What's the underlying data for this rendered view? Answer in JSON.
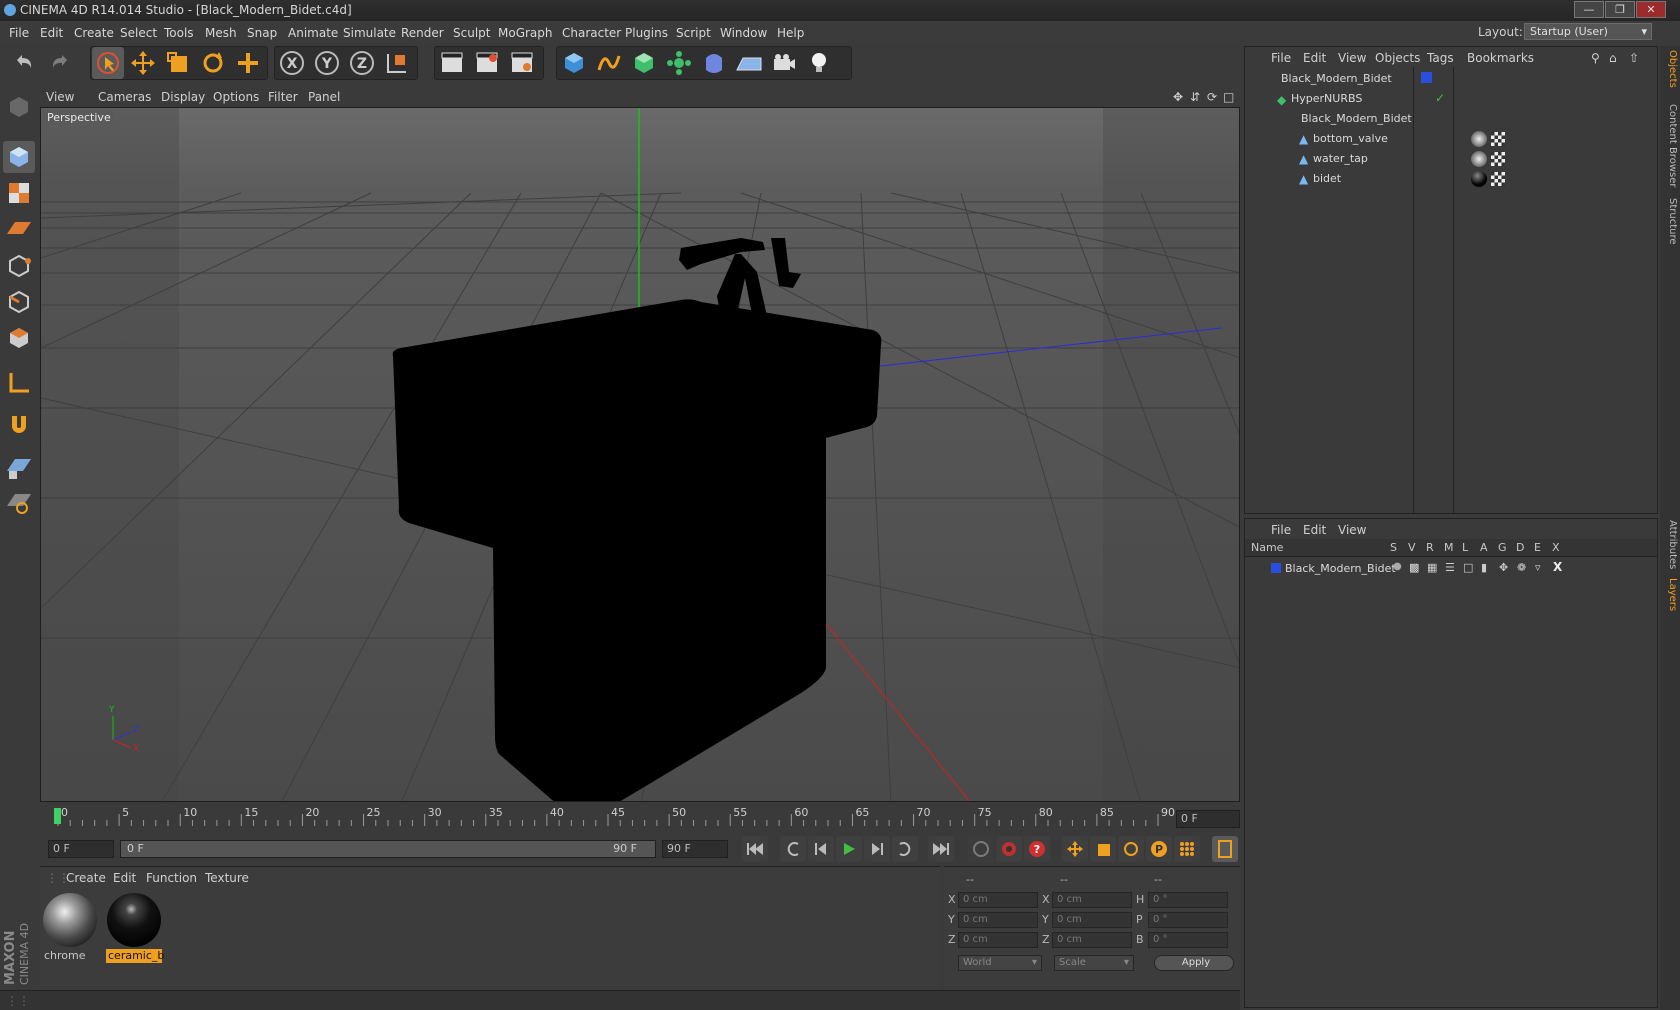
{
  "window": {
    "title": "CINEMA 4D R14.014 Studio - [Black_Modern_Bidet.c4d]"
  },
  "menubar": {
    "items": [
      "File",
      "Edit",
      "Create",
      "Select",
      "Tools",
      "Mesh",
      "Snap",
      "Animate",
      "Simulate",
      "Render",
      "Sculpt",
      "MoGraph",
      "Character",
      "Plugins",
      "Script",
      "Window",
      "Help"
    ],
    "layout_label": "Layout:",
    "layout_value": "Startup (User)"
  },
  "toolbar": {
    "icons": [
      "undo-icon",
      "redo-icon",
      "live-selection-icon",
      "move-icon",
      "scale-icon",
      "rotate-icon",
      "add-icon",
      "x-axis-icon",
      "y-axis-icon",
      "z-axis-icon",
      "coordinate-system-icon",
      "render-view-icon",
      "render-picture-viewer-icon",
      "render-settings-icon",
      "cube-icon",
      "spline-icon",
      "nurbs-icon",
      "array-icon",
      "deformer-icon",
      "floor-icon",
      "camera-icon",
      "light-icon"
    ]
  },
  "viewport": {
    "menu": [
      "View",
      "Cameras",
      "Display",
      "Options",
      "Filter",
      "Panel"
    ],
    "label": "Perspective"
  },
  "timeline": {
    "ticks": [
      "0",
      "5",
      "10",
      "15",
      "20",
      "25",
      "30",
      "35",
      "40",
      "45",
      "50",
      "55",
      "60",
      "65",
      "70",
      "75",
      "80",
      "85",
      "90"
    ],
    "current_frame": "0 F",
    "start_field": "0 F",
    "range_start": "0 F",
    "range_end": "90 F",
    "end_field": "90 F"
  },
  "materials": {
    "menu": [
      "Create",
      "Edit",
      "Function",
      "Texture"
    ],
    "items": [
      {
        "name": "chrome",
        "selected": false
      },
      {
        "name": "ceramic_b",
        "selected": true
      }
    ]
  },
  "coordinates": {
    "header": [
      "--",
      "--",
      "--"
    ],
    "rows": [
      {
        "l1": "X",
        "v1": "0 cm",
        "l2": "X",
        "v2": "0 cm",
        "l3": "H",
        "v3": "0 °"
      },
      {
        "l1": "Y",
        "v1": "0 cm",
        "l2": "Y",
        "v2": "0 cm",
        "l3": "P",
        "v3": "0 °"
      },
      {
        "l1": "Z",
        "v1": "0 cm",
        "l2": "Z",
        "v2": "0 cm",
        "l3": "B",
        "v3": "0 °"
      }
    ],
    "mode": "World",
    "transform": "Scale",
    "apply": "Apply"
  },
  "objects": {
    "menu": [
      "File",
      "Edit",
      "View",
      "Objects",
      "Tags",
      "Bookmarks"
    ],
    "tree": [
      {
        "name": "Black_Modern_Bidet",
        "depth": 0
      },
      {
        "name": "HyperNURBS",
        "depth": 1
      },
      {
        "name": "Black_Modern_Bidet",
        "depth": 2
      },
      {
        "name": "bottom_valve",
        "depth": 3
      },
      {
        "name": "water_tap",
        "depth": 3
      },
      {
        "name": "bidet",
        "depth": 3
      }
    ]
  },
  "layers": {
    "menu": [
      "File",
      "Edit",
      "View"
    ],
    "columns": [
      "Name",
      "S",
      "V",
      "R",
      "M",
      "L",
      "A",
      "G",
      "D",
      "E",
      "X"
    ],
    "rows": [
      {
        "name": "Black_Modern_Bidet",
        "color": "#2a4fe0"
      }
    ]
  },
  "sidetabs": [
    "Objects",
    "Content Browser",
    "Structure",
    "Attributes",
    "Layers"
  ],
  "branding": {
    "line1": "MAXON",
    "line2": "CINEMA 4D"
  },
  "colors": {
    "accent": "#f0a020",
    "background": "#3a3a3a",
    "viewport": "#4e4e4e"
  }
}
